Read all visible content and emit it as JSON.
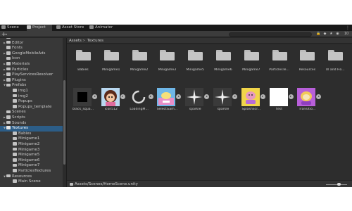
{
  "tabs": [
    {
      "label": "Scene",
      "icon": "scene-icon"
    },
    {
      "label": "Project",
      "icon": "project-folder-icon"
    },
    {
      "label": "Asset Store",
      "icon": "asset-store-icon"
    },
    {
      "label": "Animator",
      "icon": "animator-icon"
    }
  ],
  "active_tab": "Project",
  "tree": [
    {
      "label": "Animator",
      "indent": 1,
      "arrow": false
    },
    {
      "label": "Editor",
      "indent": 1,
      "arrow": true
    },
    {
      "label": "Fonts",
      "indent": 1,
      "arrow": false
    },
    {
      "label": "GoogleMobileAds",
      "indent": 1,
      "arrow": true
    },
    {
      "label": "Icon",
      "indent": 1,
      "arrow": false
    },
    {
      "label": "Materials",
      "indent": 1,
      "arrow": true
    },
    {
      "label": "Particles",
      "indent": 1,
      "arrow": true
    },
    {
      "label": "PlayServicesResolver",
      "indent": 1,
      "arrow": true
    },
    {
      "label": "Plugins",
      "indent": 1,
      "arrow": true
    },
    {
      "label": "Prefabs",
      "indent": 1,
      "arrow": "open"
    },
    {
      "label": "img1",
      "indent": 2,
      "arrow": false
    },
    {
      "label": "img2",
      "indent": 2,
      "arrow": false
    },
    {
      "label": "Popups",
      "indent": 2,
      "arrow": false
    },
    {
      "label": "Popups_template",
      "indent": 2,
      "arrow": false
    },
    {
      "label": "Scenes",
      "indent": 1,
      "arrow": false
    },
    {
      "label": "Scripts",
      "indent": 1,
      "arrow": true
    },
    {
      "label": "Sounds",
      "indent": 1,
      "arrow": true
    },
    {
      "label": "Textures",
      "indent": 1,
      "arrow": "open",
      "selected": true
    },
    {
      "label": "Babies",
      "indent": 2,
      "arrow": false
    },
    {
      "label": "Minigame1",
      "indent": 2,
      "arrow": false
    },
    {
      "label": "Minigame2",
      "indent": 2,
      "arrow": false
    },
    {
      "label": "Minigame3",
      "indent": 2,
      "arrow": false
    },
    {
      "label": "Minigame5",
      "indent": 2,
      "arrow": false
    },
    {
      "label": "Minigame6",
      "indent": 2,
      "arrow": false
    },
    {
      "label": "Minigame7",
      "indent": 2,
      "arrow": false
    },
    {
      "label": "ParticlesTextures",
      "indent": 2,
      "arrow": false
    },
    {
      "label": "Resources",
      "indent": 1,
      "arrow": "open"
    },
    {
      "label": "Main Scene",
      "indent": 2,
      "arrow": false
    }
  ],
  "breadcrumb": [
    "Assets",
    "Textures"
  ],
  "folders": [
    "Babies",
    "Minigame1",
    "Minigame2",
    "Minigame3",
    "Minigame5",
    "Minigame6",
    "Minigame7",
    "ParticlesTe...",
    "Resources",
    "UI and Ho..."
  ],
  "assets": [
    {
      "label": "black_squa...",
      "icon": "black-square-texture-icon"
    },
    {
      "label": "icon512",
      "icon": "girl-character-icon"
    },
    {
      "label": "LoadingM...",
      "icon": "loading-ring-icon"
    },
    {
      "label": "SelectGam...",
      "icon": "select-game-icon"
    },
    {
      "label": "sparkle",
      "icon": "sparkle-icon"
    },
    {
      "label": "sparkle",
      "icon": "sparkle-icon"
    },
    {
      "label": "SplashScr...",
      "icon": "splash-screen-icon"
    },
    {
      "label": "test",
      "icon": "white-square-texture-icon"
    },
    {
      "label": "Transitio...",
      "icon": "transition-icon"
    }
  ],
  "status": {
    "path": "Assets/Scenes/HomeScene.unity"
  },
  "toolbar": {
    "plus": "+",
    "caret": "▾",
    "menu": "⋮",
    "lock": "🔒",
    "eye": "◉",
    "tag": "◆",
    "star": "★",
    "count": "10"
  },
  "colors": {
    "selection": "#2c5d87",
    "background": "#282828",
    "panel": "#383838"
  }
}
